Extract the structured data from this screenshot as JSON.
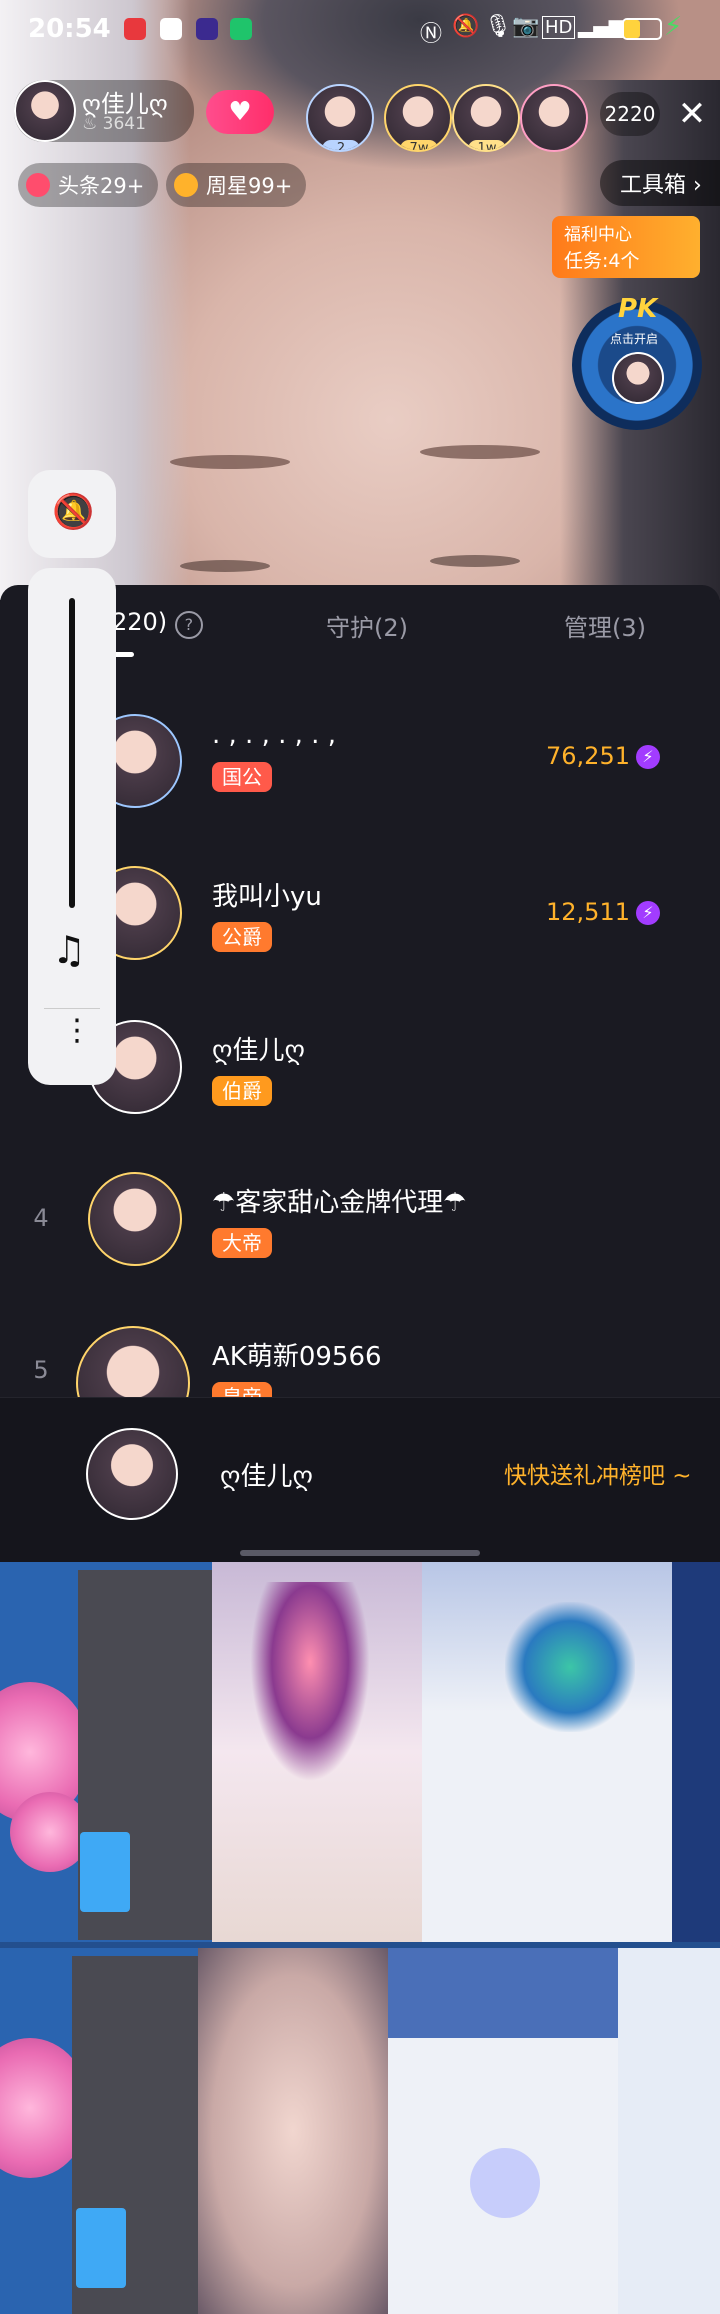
{
  "status_bar": {
    "time": "20:54",
    "battery_icon": "battery-icon"
  },
  "host": {
    "name": "ღ佳儿ღ",
    "fans": "3641"
  },
  "top_fans": [
    {
      "badge": "2",
      "color": "#b9d4ff"
    },
    {
      "badge": "7w",
      "color": "#ffd56b"
    },
    {
      "badge": "1w",
      "color": "#ffe08a"
    }
  ],
  "viewer_count": "2220",
  "tags": {
    "headline": "头条29+",
    "weekly_star": "周星99+"
  },
  "toolbox": "工具箱 ›",
  "welfare": {
    "title": "福利中心",
    "task": "任务:4个"
  },
  "pk": {
    "label": "PK",
    "sub": "点击开启"
  },
  "tabs": {
    "audience": "220)",
    "guard": "守护(2)",
    "admin": "管理(3)"
  },
  "ranking": [
    {
      "rank": "",
      "name": ". ,  . ,  . ,  . ,",
      "badge": "国公",
      "badge_color": "#ff5a4a",
      "score": "76,251"
    },
    {
      "rank": "",
      "name": "我叫小yu",
      "badge": "公爵",
      "badge_color": "#ff7a2e",
      "score": "12,511"
    },
    {
      "rank": "",
      "name": "ღ佳儿ღ",
      "badge": "伯爵",
      "badge_color": "#ff9a1e",
      "score": ""
    },
    {
      "rank": "4",
      "name": "☂客家甜心金牌代理☂",
      "badge": "大帝",
      "badge_color": "#ff7a2e",
      "score": ""
    },
    {
      "rank": "5",
      "name": "AK萌新09566",
      "badge": "皇帝",
      "badge_color": "#ff7a2e",
      "score": ""
    }
  ],
  "my_entry": {
    "name": "ღ佳儿ღ",
    "cta": "快快送礼冲榜吧 ~"
  }
}
